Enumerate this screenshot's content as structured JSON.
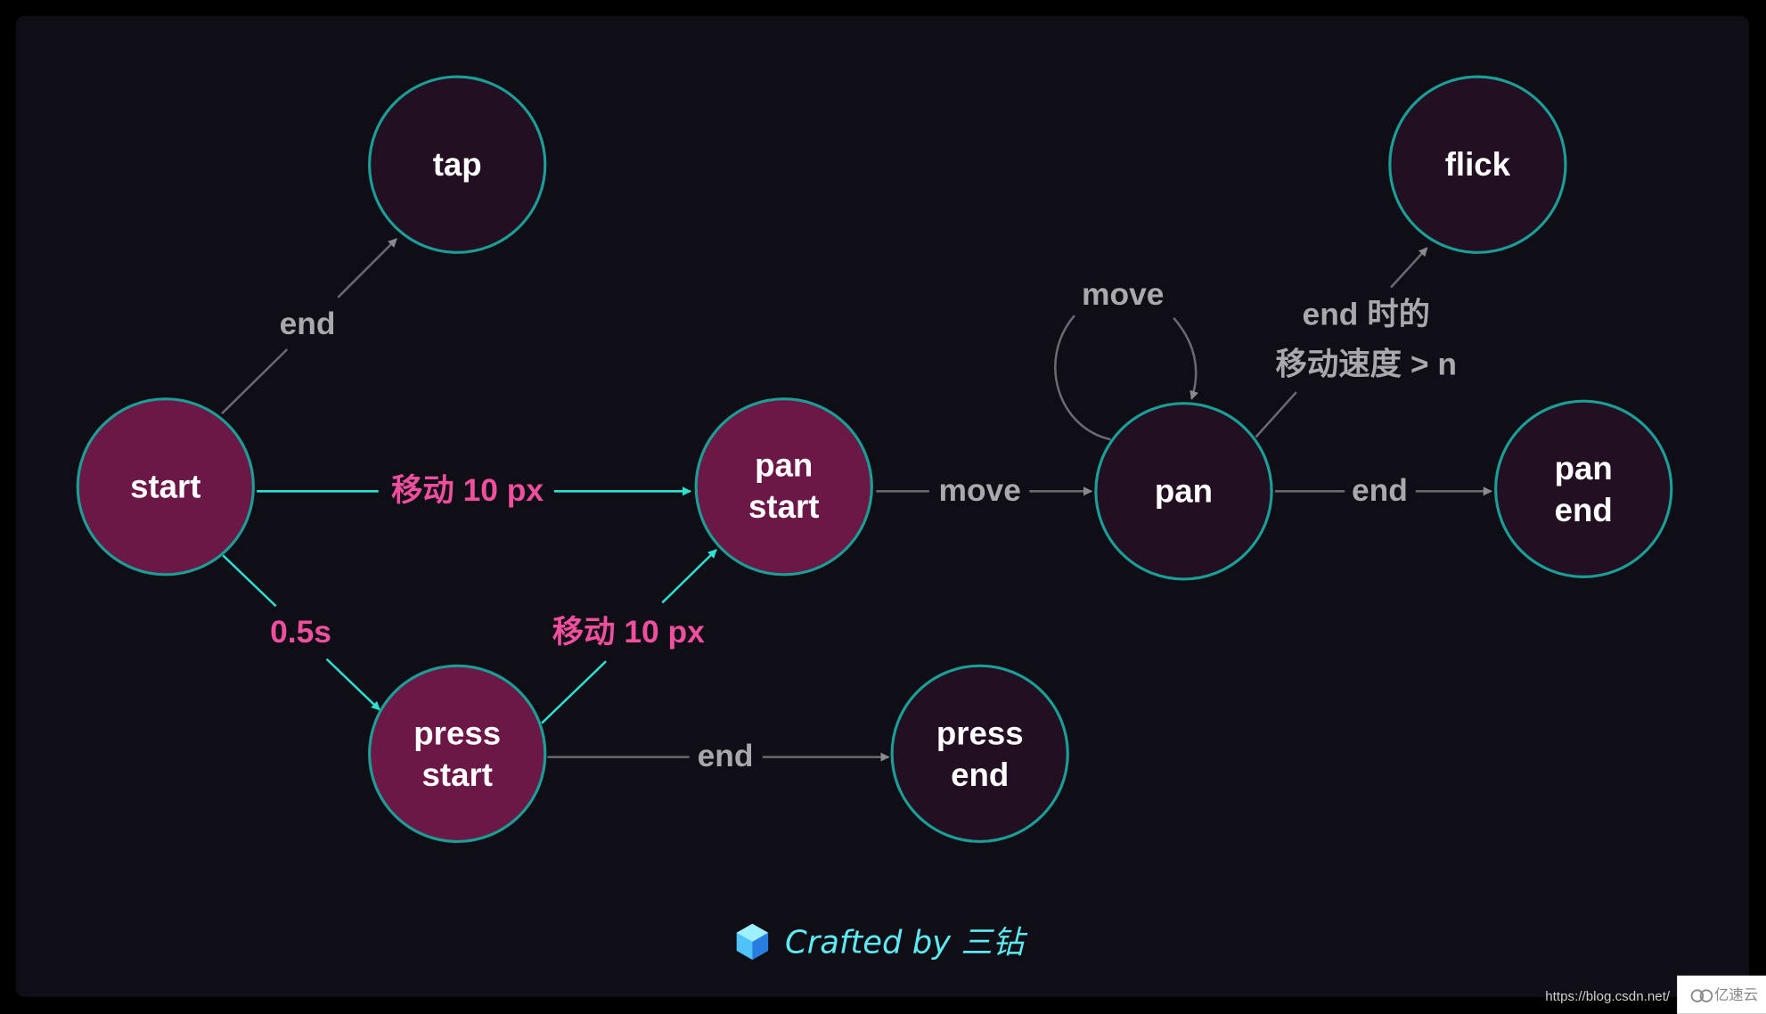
{
  "colors": {
    "background": "#0f0e17",
    "node_active": "#6b1846",
    "node_inactive": "#220f22",
    "node_border": "#1a9e96",
    "edge_gray": "#6a6a6e",
    "edge_teal": "#2ee0d0",
    "label_pink": "#ef4f9c",
    "label_gray": "#a9a9ad",
    "credit": "#5eeaf0"
  },
  "nodes": {
    "start": {
      "lines": [
        "start"
      ],
      "kind": "active"
    },
    "tap": {
      "lines": [
        "tap"
      ],
      "kind": "inactive"
    },
    "pan_start": {
      "lines": [
        "pan",
        "start"
      ],
      "kind": "active"
    },
    "pan": {
      "lines": [
        "pan"
      ],
      "kind": "inactive"
    },
    "flick": {
      "lines": [
        "flick"
      ],
      "kind": "inactive"
    },
    "pan_end": {
      "lines": [
        "pan",
        "end"
      ],
      "kind": "inactive"
    },
    "press_start": {
      "lines": [
        "press",
        "start"
      ],
      "kind": "active"
    },
    "press_end": {
      "lines": [
        "press",
        "end"
      ],
      "kind": "inactive"
    }
  },
  "edges": {
    "start_tap": {
      "from": "start",
      "to": "tap",
      "label": "end"
    },
    "start_pan_start": {
      "from": "start",
      "to": "pan start",
      "label": "移动 10 px"
    },
    "start_press_start": {
      "from": "start",
      "to": "press start",
      "label": "0.5s"
    },
    "press_start_pan_start": {
      "from": "press start",
      "to": "pan start",
      "label": "移动 10 px"
    },
    "press_start_press_end": {
      "from": "press start",
      "to": "press end",
      "label": "end"
    },
    "pan_start_pan": {
      "from": "pan start",
      "to": "pan",
      "label": "move"
    },
    "pan_pan": {
      "from": "pan",
      "to": "pan",
      "label": "move"
    },
    "pan_flick": {
      "from": "pan",
      "to": "flick",
      "label_lines": [
        "end 时的",
        "移动速度 > n"
      ]
    },
    "pan_pan_end": {
      "from": "pan",
      "to": "pan end",
      "label": "end"
    }
  },
  "footer": {
    "credit": "Crafted by 三钻",
    "icon": "cube-icon"
  },
  "watermark": {
    "url": "https://blog.csdn.net/",
    "brand": "亿速云"
  }
}
